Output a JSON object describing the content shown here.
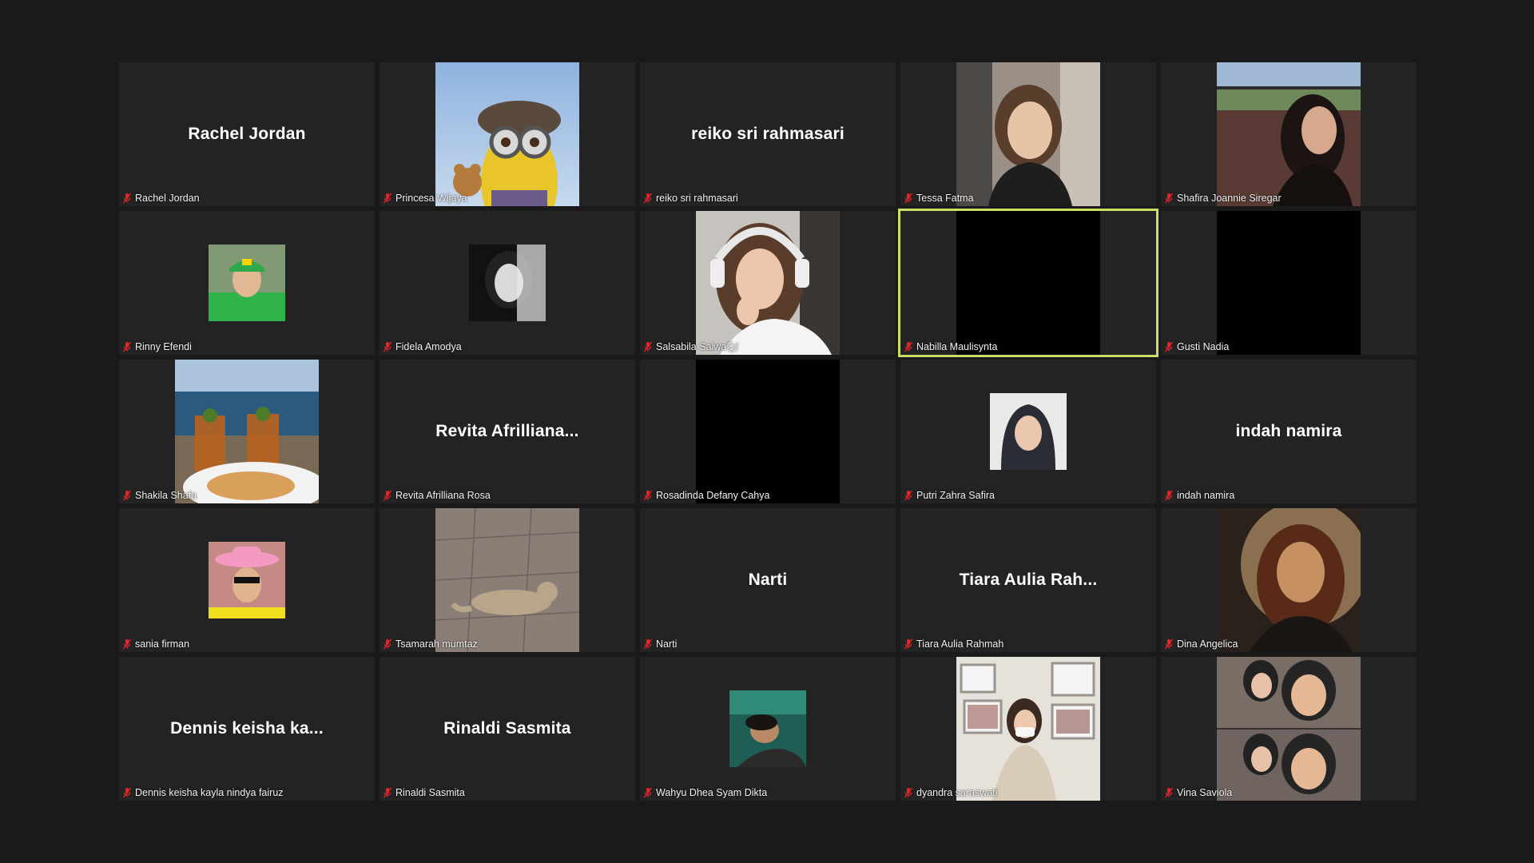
{
  "colors": {
    "background": "#1a1a1a",
    "tile": "#232323",
    "active_speaker_border": "#c9de62",
    "mute_icon": "#e5252a"
  },
  "participants": [
    {
      "name": "Rachel Jordan",
      "display": "Rachel Jordan",
      "muted": true
    },
    {
      "name": "Princesa Wijaya",
      "muted": true,
      "media": "video"
    },
    {
      "name": "reiko sri rahmasari",
      "display": "reiko sri rahmasari",
      "muted": true
    },
    {
      "name": "Tessa Fatma",
      "muted": true,
      "media": "video"
    },
    {
      "name": "Shafira Joannie Siregar",
      "muted": true,
      "media": "video"
    },
    {
      "name": "Rinny Efendi",
      "muted": true,
      "media": "avatar"
    },
    {
      "name": "Fidela Amodya",
      "muted": true,
      "media": "avatar"
    },
    {
      "name": "Salsabila Salwa🐿",
      "muted": true,
      "media": "video"
    },
    {
      "name": "Nabilla Maulisynta",
      "muted": true,
      "media": "video-off",
      "active_speaker": true
    },
    {
      "name": "Gusti Nadia",
      "muted": true,
      "media": "video-off"
    },
    {
      "name": "Shakila Shafa",
      "muted": true,
      "media": "video"
    },
    {
      "name": "Revita Afrilliana Rosa",
      "display": "Revita  Afrilliana...",
      "muted": true
    },
    {
      "name": "Rosadinda Defany Cahya",
      "muted": true,
      "media": "video-off"
    },
    {
      "name": "Putri Zahra Safira",
      "muted": true,
      "media": "avatar"
    },
    {
      "name": "indah namira",
      "display": "indah namira",
      "muted": true
    },
    {
      "name": "sania firman",
      "muted": true,
      "media": "avatar"
    },
    {
      "name": "Tsamarah mumtaz",
      "muted": true,
      "media": "video"
    },
    {
      "name": "Narti",
      "display": "Narti",
      "muted": true
    },
    {
      "name": "Tiara Aulia Rahmah",
      "display": "Tiara  Aulia  Rah...",
      "muted": true
    },
    {
      "name": "Dina Angelica",
      "muted": true,
      "media": "video"
    },
    {
      "name": "Dennis keisha kayla nindya fairuz",
      "display": "Dennis  keisha  ka...",
      "muted": true
    },
    {
      "name": "Rinaldi Sasmita",
      "display": "Rinaldi Sasmita",
      "muted": true
    },
    {
      "name": "Wahyu Dhea Syam Dikta",
      "muted": true,
      "media": "avatar"
    },
    {
      "name": "dyandra saraswati",
      "muted": true,
      "media": "video"
    },
    {
      "name": "Vina Saviola",
      "muted": true,
      "media": "video"
    }
  ]
}
